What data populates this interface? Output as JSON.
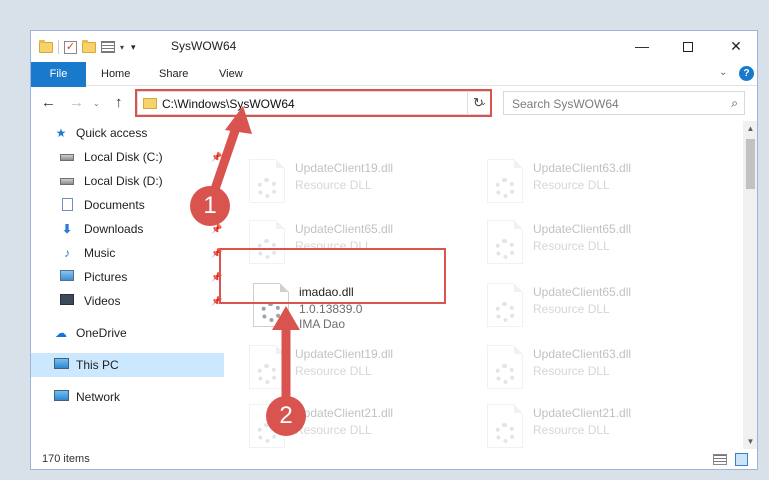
{
  "window": {
    "title": "SysWOW64",
    "minimize_label": "—",
    "close_label": "✕"
  },
  "ribbon": {
    "tabs": [
      "File",
      "Home",
      "Share",
      "View"
    ],
    "expand_label": "⌄",
    "help_label": "?"
  },
  "nav": {
    "back_label": "←",
    "forward_label": "→",
    "recent_label": "⌄",
    "up_label": "↑"
  },
  "address": {
    "path": "C:\\Windows\\SysWOW64",
    "dropdown_label": "⌄",
    "refresh_label": "↻"
  },
  "search": {
    "placeholder": "Search SysWOW64",
    "icon_label": "⌕"
  },
  "sidebar": {
    "items": [
      {
        "label": "Quick access",
        "icon": "star-icon",
        "pinned": false
      },
      {
        "label": "Local Disk (C:)",
        "icon": "drive-icon",
        "pinned": true
      },
      {
        "label": "Local Disk (D:)",
        "icon": "drive-icon",
        "pinned": false
      },
      {
        "label": "Documents",
        "icon": "documents-icon",
        "pinned": true
      },
      {
        "label": "Downloads",
        "icon": "download-icon",
        "pinned": true
      },
      {
        "label": "Music",
        "icon": "music-icon",
        "pinned": true
      },
      {
        "label": "Pictures",
        "icon": "pictures-icon",
        "pinned": true
      },
      {
        "label": "Videos",
        "icon": "videos-icon",
        "pinned": true
      },
      {
        "label": "OneDrive",
        "icon": "cloud-icon",
        "pinned": false
      },
      {
        "label": "This PC",
        "icon": "computer-icon",
        "pinned": false
      },
      {
        "label": "Network",
        "icon": "network-icon",
        "pinned": false
      }
    ],
    "star_glyph": "★",
    "download_glyph": "⬇",
    "music_glyph": "♪",
    "cloud_glyph": "☁",
    "pin_glyph": "📌"
  },
  "files": [
    {
      "name": "UpdateClient19.dll",
      "line2": "Resource DLL",
      "faded": true
    },
    {
      "name": "UpdateClient63.dll",
      "line2": "Resource DLL",
      "faded": true
    },
    {
      "name": "UpdateClient65.dll",
      "line2": "Resource DLL",
      "faded": true
    },
    {
      "name": "UpdateClient65.dll",
      "line2": "Resource DLL",
      "faded": true
    },
    {
      "name": "imadao.dll",
      "line2": "1.0.13839.0",
      "line3": "IMA Dao",
      "faded": false
    },
    {
      "name": "UpdateClient65.dll",
      "line2": "Resource DLL",
      "faded": true
    },
    {
      "name": "UpdateClient19.dll",
      "line2": "Resource DLL",
      "faded": true
    },
    {
      "name": "UpdateClient63.dll",
      "line2": "Resource DLL",
      "faded": true
    },
    {
      "name": "UpdateClient21.dll",
      "line2": "Resource DLL",
      "faded": true
    },
    {
      "name": "UpdateClient21.dll",
      "line2": "Resource DLL",
      "faded": true
    }
  ],
  "scrollbar": {
    "up_label": "▲",
    "down_label": "▼"
  },
  "status": {
    "item_count": "170 items"
  },
  "annotations": {
    "step1": "1",
    "step2": "2",
    "color": "#d9534f"
  }
}
